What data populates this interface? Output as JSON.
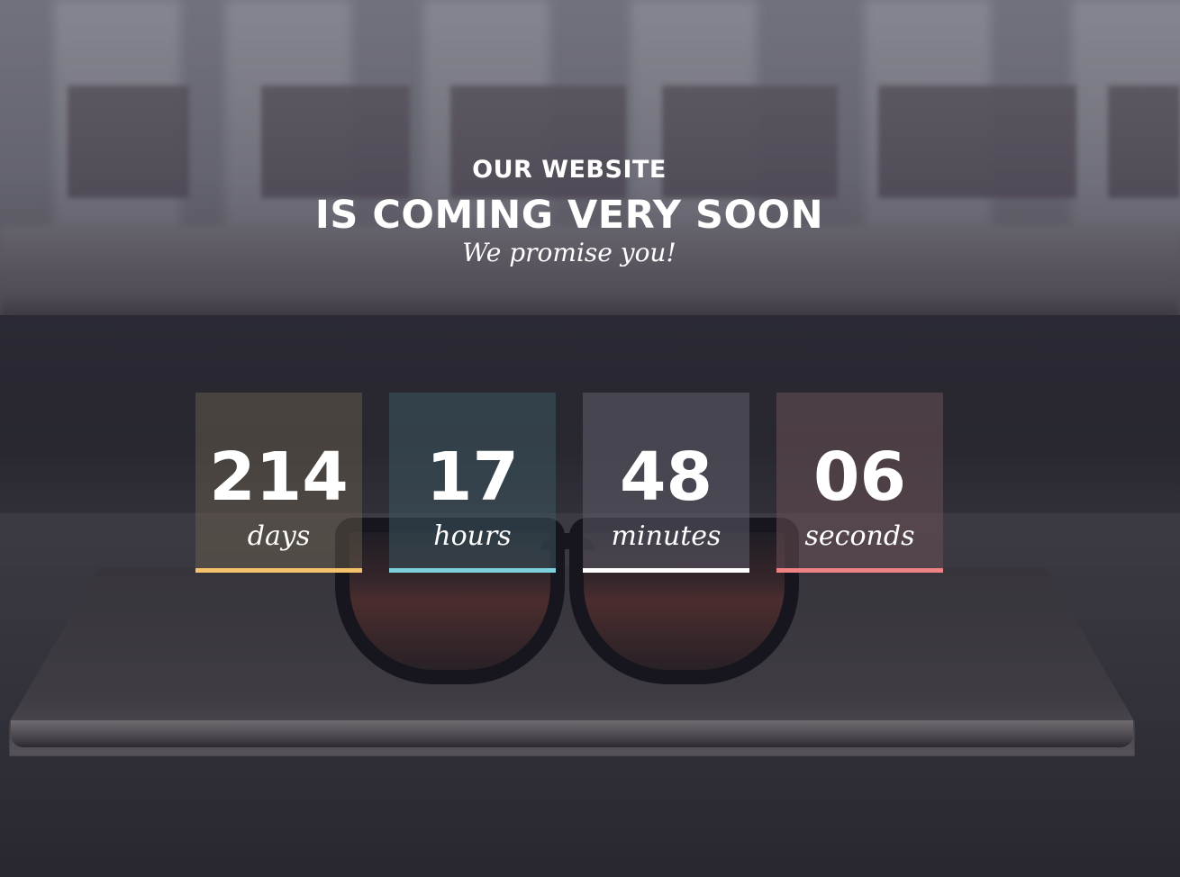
{
  "header": {
    "subtitle": "OUR WEBSITE",
    "title": "IS COMING VERY SOON",
    "tagline": "We promise you!"
  },
  "countdown": [
    {
      "value": "214",
      "label": "days",
      "accent": "#f5c26b",
      "tint": "rgba(110,100,80,0.45)"
    },
    {
      "value": "17",
      "label": "hours",
      "accent": "#7ed0dc",
      "tint": "rgba(60,85,95,0.55)"
    },
    {
      "value": "48",
      "label": "minutes",
      "accent": "#ffffff",
      "tint": "rgba(95,92,105,0.55)"
    },
    {
      "value": "06",
      "label": "seconds",
      "accent": "#ef8383",
      "tint": "rgba(105,80,85,0.55)"
    }
  ]
}
